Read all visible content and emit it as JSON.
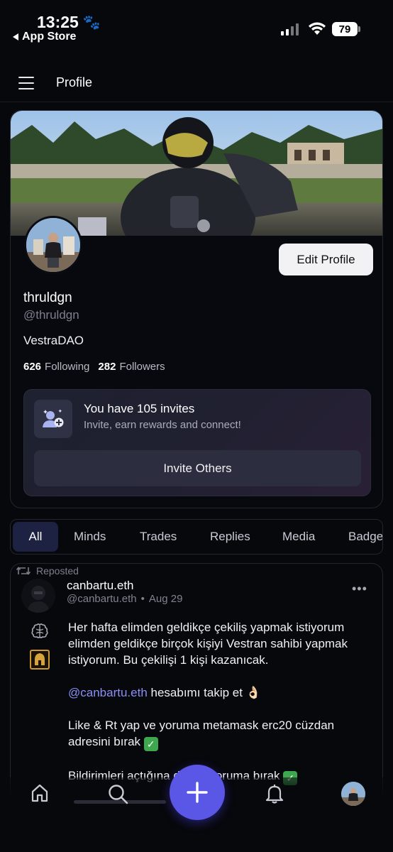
{
  "status_bar": {
    "time": "13:25",
    "back_app": "App Store",
    "battery": "79"
  },
  "header": {
    "title": "Profile"
  },
  "profile": {
    "display_name": "thruldgn",
    "handle": "@thruldgn",
    "bio": "VestraDAO",
    "edit_label": "Edit Profile",
    "following_count": "626",
    "following_label": "Following",
    "followers_count": "282",
    "followers_label": "Followers"
  },
  "invite": {
    "title": "You have 105 invites",
    "subtitle": "Invite, earn rewards and connect!",
    "button": "Invite Others"
  },
  "tabs": [
    {
      "label": "All",
      "active": true
    },
    {
      "label": "Minds"
    },
    {
      "label": "Trades"
    },
    {
      "label": "Replies"
    },
    {
      "label": "Media"
    },
    {
      "label": "Badge"
    }
  ],
  "post": {
    "repost_label": "Reposted",
    "author_name": "canbartu.eth",
    "author_handle": "@canbartu.eth",
    "separator": "•",
    "date": "Aug 29",
    "more": "•••",
    "para1": "Her hafta elimden geldikçe çekiliş yapmak istiyorum elimden geldikçe birçok kişiyi Vestran sahibi yapmak istiyorum. Bu çekilişi 1 kişi kazanıcak.",
    "mention": "@canbartu.eth",
    "para2_rest": " hesabımı takip et 👌🏻",
    "para3": "Like & Rt yap ve yoruma metamask erc20 cüzdan adresini bırak",
    "para4": "Bildirimleri açtığına dair bi yoruma bırak",
    "check": "✓"
  },
  "icons": {
    "menu": "hamburger-icon",
    "invite": "user-plus-icon",
    "repost": "repost-icon",
    "home": "home-icon",
    "search": "search-icon",
    "compose": "plus-icon",
    "notifications": "bell-icon"
  },
  "colors": {
    "accent": "#5b57e6",
    "mention": "#8b8ff5",
    "tab_active_bg": "#1e2242",
    "background": "#07080c"
  }
}
